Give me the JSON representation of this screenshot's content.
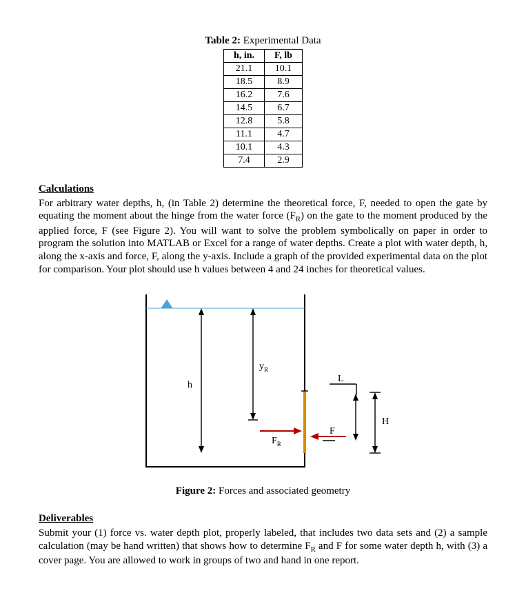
{
  "table": {
    "title_bold": "Table 2:",
    "title_rest": " Experimental Data",
    "headers": {
      "h": "h, in.",
      "f": "F, lb"
    },
    "rows": [
      {
        "h": "21.1",
        "f": "10.1"
      },
      {
        "h": "18.5",
        "f": "8.9"
      },
      {
        "h": "16.2",
        "f": "7.6"
      },
      {
        "h": "14.5",
        "f": "6.7"
      },
      {
        "h": "12.8",
        "f": "5.8"
      },
      {
        "h": "11.1",
        "f": "4.7"
      },
      {
        "h": "10.1",
        "f": "4.3"
      },
      {
        "h": "7.4",
        "f": "2.9"
      }
    ]
  },
  "calc": {
    "heading": "Calculations",
    "text_pre": "For arbitrary water depths, h, (in Table 2) determine the theoretical force, F, needed to open the gate by equating the moment about the hinge from the water force (F",
    "text_sub": "R",
    "text_post": ") on the gate to the moment produced by the applied force, F (see Figure 2). You will want to solve the problem symbolically on paper in order to program the solution into MATLAB or Excel for a range of water depths. Create a plot with water depth, h, along the x-axis and force, F, along the y-axis. Include a graph of the provided experimental data on the plot for comparison. Your plot should use h values between 4 and 24 inches for theoretical values."
  },
  "figure": {
    "caption_bold": "Figure 2:",
    "caption_rest": " Forces and associated geometry",
    "labels": {
      "h": "h",
      "yR": "y",
      "yR_sub": "R",
      "FR": "F",
      "FR_sub": "R",
      "F": "F",
      "L": "L",
      "H": "H",
      "nabla": "▽"
    }
  },
  "deliv": {
    "heading": "Deliverables",
    "text_pre": "Submit your (1) force vs. water depth plot, properly labeled, that includes two data sets and (2) a sample calculation (may be hand written) that shows how to determine F",
    "text_sub": "R",
    "text_post": " and F for some water depth h, with (3) a cover page. You are allowed to work in groups of two and hand in one report."
  },
  "chart_data": {
    "type": "table",
    "title": "Table 2: Experimental Data",
    "columns": [
      "h, in.",
      "F, lb"
    ],
    "rows": [
      [
        21.1,
        10.1
      ],
      [
        18.5,
        8.9
      ],
      [
        16.2,
        7.6
      ],
      [
        14.5,
        6.7
      ],
      [
        12.8,
        5.8
      ],
      [
        11.1,
        4.7
      ],
      [
        10.1,
        4.3
      ],
      [
        7.4,
        2.9
      ]
    ]
  }
}
